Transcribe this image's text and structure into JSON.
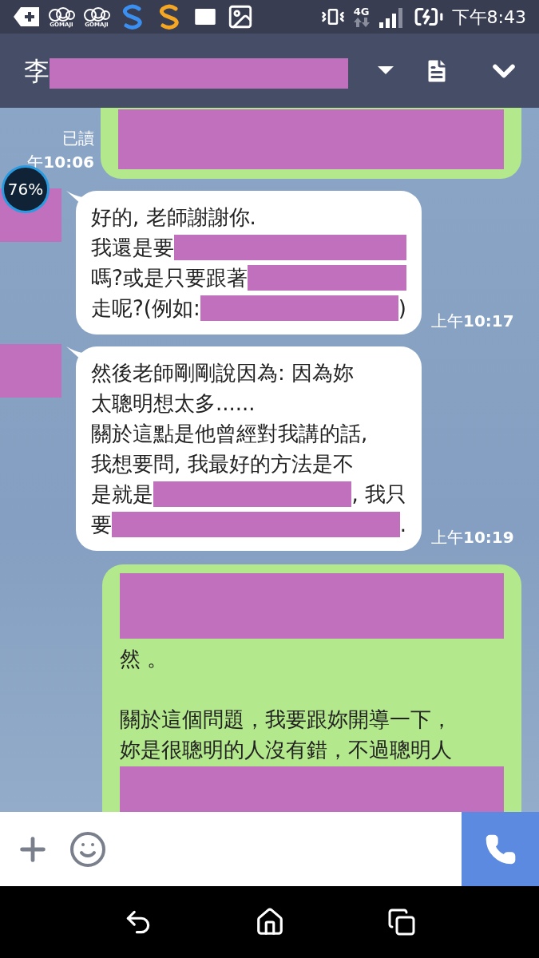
{
  "status_bar": {
    "gomaji_labels": [
      "GOMAJI",
      "GOMAJI"
    ],
    "network": "4G",
    "time": "下午8:43"
  },
  "header": {
    "title": "李"
  },
  "battery_widget": {
    "text": "76%"
  },
  "messages": [
    {
      "kind": "outgoing",
      "read": "已讀",
      "time": "午**10:06**",
      "blocks": [
        {
          "kind": "redaction"
        }
      ]
    },
    {
      "kind": "incoming",
      "time": "上午**10:17**",
      "lines": [
        [
          {
            "kind": "text",
            "text": "好的, 老師謝謝你."
          }
        ],
        [
          {
            "kind": "text",
            "text": "我還是要"
          },
          {
            "kind": "redaction"
          }
        ],
        [
          {
            "kind": "text",
            "text": "嗎?或是只要跟著"
          },
          {
            "kind": "redaction"
          }
        ],
        [
          {
            "kind": "text",
            "text": "走呢?(例如: "
          },
          {
            "kind": "redaction"
          },
          {
            "kind": "text",
            "text": ")"
          }
        ]
      ]
    },
    {
      "kind": "incoming",
      "time": "上午**10:19**",
      "lines": [
        [
          {
            "kind": "text",
            "text": "然後老師剛剛說因為: 因為妳"
          }
        ],
        [
          {
            "kind": "text",
            "text": "太聰明想太多......"
          }
        ],
        [
          {
            "kind": "text",
            "text": "關於這點是他曾經對我講的話,"
          }
        ],
        [
          {
            "kind": "text",
            "text": "我想要問, 我最好的方法是不"
          }
        ],
        [
          {
            "kind": "text",
            "text": "是就是"
          },
          {
            "kind": "redaction"
          },
          {
            "kind": "text",
            "text": ", 我只"
          }
        ],
        [
          {
            "kind": "text",
            "text": "要"
          },
          {
            "kind": "redaction"
          },
          {
            "kind": "text",
            "text": "."
          }
        ]
      ]
    },
    {
      "kind": "outgoing",
      "blocks": [
        {
          "kind": "redaction"
        },
        {
          "kind": "text",
          "text": "然 。"
        },
        {
          "kind": "blank"
        },
        {
          "kind": "text",
          "text": "關於這個問題，我要跟妳開導一下，"
        },
        {
          "kind": "text",
          "text": "妳是很聰明的人沒有錯，不過聰明人"
        },
        {
          "kind": "redaction"
        }
      ]
    }
  ]
}
